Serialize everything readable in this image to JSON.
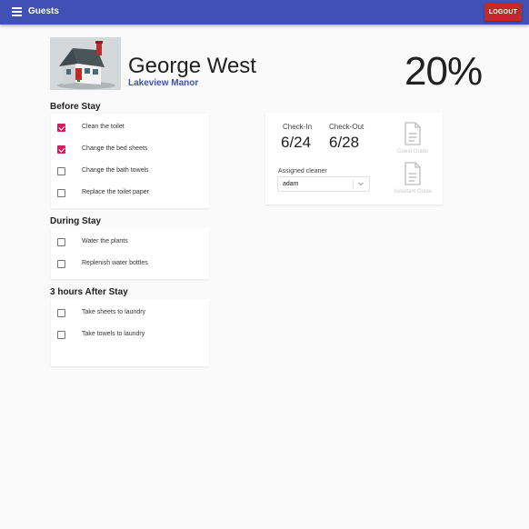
{
  "appbar": {
    "title": "Guests",
    "logout_label": "LOGOUT"
  },
  "guest": {
    "name": "George West",
    "property": "Lakeview Manor",
    "progress_percent": "20%",
    "progress_value": 20
  },
  "sections": [
    {
      "title": "Before Stay",
      "tasks": [
        {
          "label": "Clean the toilet",
          "checked": true
        },
        {
          "label": "Change the bed sheets",
          "checked": true
        },
        {
          "label": "Change the bath towels",
          "checked": false
        },
        {
          "label": "Replace the toilet paper",
          "checked": false
        }
      ]
    },
    {
      "title": "During Stay",
      "tasks": [
        {
          "label": "Water the plants",
          "checked": false
        },
        {
          "label": "Replenish water bottles",
          "checked": false
        }
      ]
    },
    {
      "title": "3 hours After Stay",
      "tasks": [
        {
          "label": "Take sheets to laundry",
          "checked": false
        },
        {
          "label": "Take towels to laundry",
          "checked": false
        }
      ]
    }
  ],
  "details": {
    "check_in_label": "Check-In",
    "check_in_value": "6/24",
    "check_out_label": "Check-Out",
    "check_out_value": "6/28",
    "cleaner_label": "Assigned cleaner",
    "cleaner_value": "adam",
    "guest_guide_label": "Guest Guide",
    "assistant_guide_label": "Assistant Guide"
  },
  "colors": {
    "primary": "#3f51b5",
    "logout": "#c62828",
    "checkbox": "#d81b60",
    "background": "#fafafa"
  },
  "icons": {
    "menu": "menu-icon",
    "house": "house-image",
    "guide": "document-icon",
    "dropdown": "chevron-down-icon"
  }
}
